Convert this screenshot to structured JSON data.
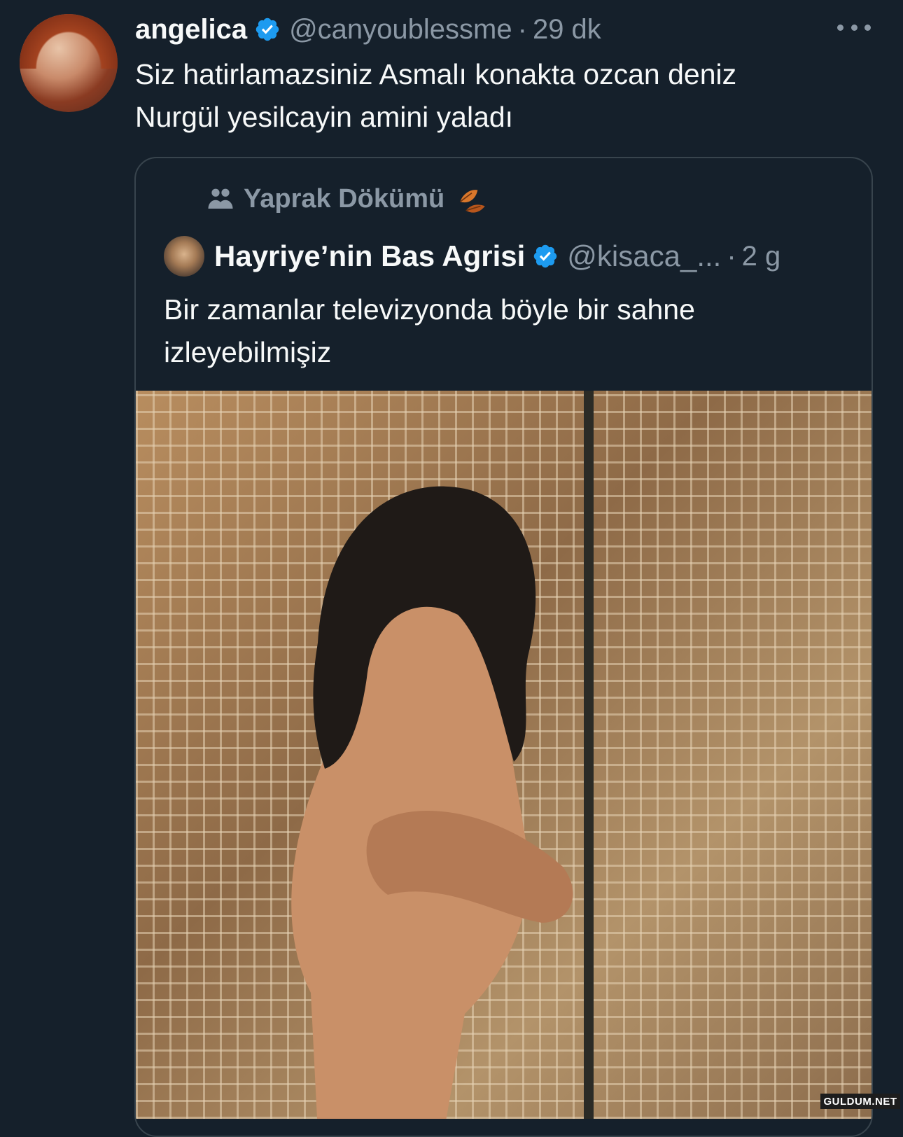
{
  "tweet": {
    "author_name": "angelica",
    "handle": "@canyoublessme",
    "separator": "·",
    "time": "29 dk",
    "verified": true,
    "text_lines": [
      "Siz hatirlamazsiniz Asmalı konakta ozcan deniz",
      "Nurgül yesilcayin amini yaladı"
    ]
  },
  "quoted": {
    "community": "Yaprak Dökümü",
    "author_name": "Hayriye’nin Bas Agrisi",
    "handle": "@kisaca_...",
    "separator": "·",
    "time": "2 g",
    "verified": true,
    "text_lines": [
      "Bir zamanlar televizyonda böyle bir sahne",
      "izleyebilmişiz"
    ]
  },
  "watermark": "GULDUM.NET",
  "colors": {
    "background": "#15202b",
    "text": "#f7f9f9",
    "muted": "#8b98a5",
    "verified": "#1d9bf0",
    "border": "#38444d"
  },
  "icons": {
    "verified": "verified-badge-icon",
    "more": "more-options-icon",
    "community": "community-people-icon",
    "leaf": "autumn-leaves-icon"
  }
}
